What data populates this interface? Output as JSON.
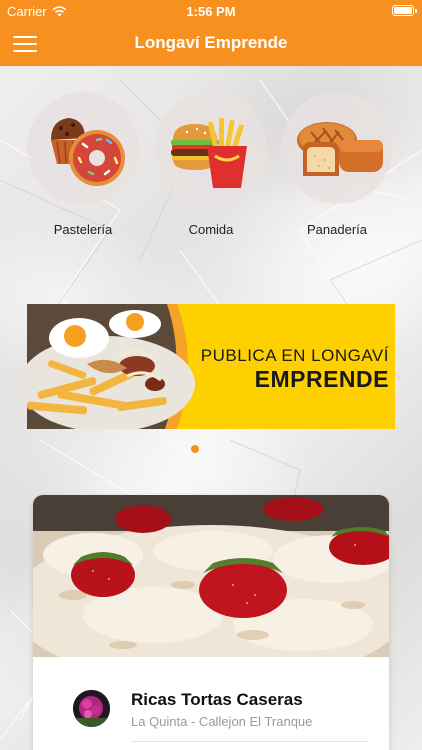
{
  "status": {
    "carrier": "Carrier",
    "time": "1:56 PM"
  },
  "nav": {
    "title": "Longaví Emprende",
    "menu_icon": "hamburger-menu-icon"
  },
  "categories": [
    {
      "label": "Pastelería",
      "icon": "cake-donut-icon"
    },
    {
      "label": "Comida",
      "icon": "burger-fries-icon"
    },
    {
      "label": "Panadería",
      "icon": "bread-icon"
    }
  ],
  "banner": {
    "line1": "PUBLICA EN LONGAVÍ",
    "line2": "EMPRENDE"
  },
  "pager": {
    "active": 1,
    "count": 1
  },
  "card": {
    "title": "Ricas Tortas Caseras",
    "subtitle": "La Quinta - Callejon El Tranque"
  },
  "colors": {
    "accent": "#f7901e",
    "banner_yellow": "#fed000"
  }
}
